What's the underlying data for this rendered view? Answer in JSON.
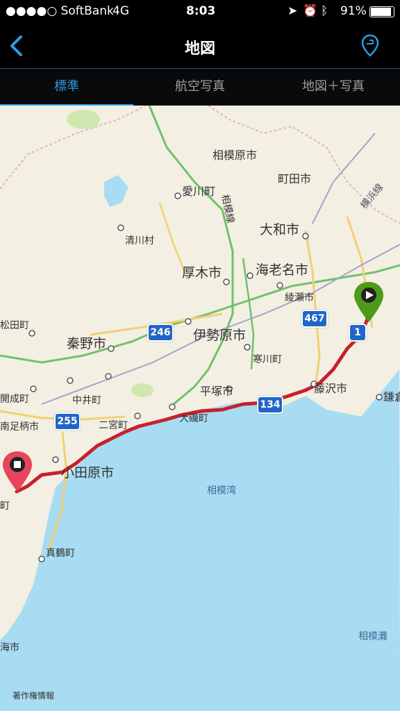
{
  "status_bar": {
    "carrier": "●●●●○ SoftBank",
    "network": "4G",
    "time": "8:03",
    "battery": "91%"
  },
  "nav": {
    "title": "地図",
    "back_icon": "chevron-left-icon",
    "action_icon": "route-pin-icon"
  },
  "tabs": [
    {
      "label": "標準",
      "active": true
    },
    {
      "label": "航空写真",
      "active": false
    },
    {
      "label": "地図＋写真",
      "active": false
    }
  ],
  "map": {
    "places": [
      "相模原市",
      "町田市",
      "愛川町",
      "清川村",
      "大和市",
      "厚木市",
      "海老名市",
      "綾瀬市",
      "伊勢原市",
      "寒川町",
      "秦野市",
      "平塚市",
      "藤沢市",
      "中井町",
      "二宮町",
      "大磯町",
      "小田原市",
      "真鶴町",
      "松田町",
      "開成町",
      "南足柄市",
      "鎌倉",
      "町",
      "海市"
    ],
    "rail_labels": [
      "相模線",
      "横浜線"
    ],
    "water_labels": [
      "相模湾",
      "相模灘"
    ],
    "route_shields": [
      "246",
      "467",
      "1",
      "255",
      "134"
    ],
    "start_marker": "play-icon",
    "end_marker": "stop-icon",
    "copyright": "著作権情報",
    "colors": {
      "land": "#f3efe3",
      "sea": "#a7dcf2",
      "route": "#c8202a",
      "start_pin": "#4e9a1a",
      "end_pin": "#e8445e",
      "accent": "#2e9be6"
    }
  }
}
